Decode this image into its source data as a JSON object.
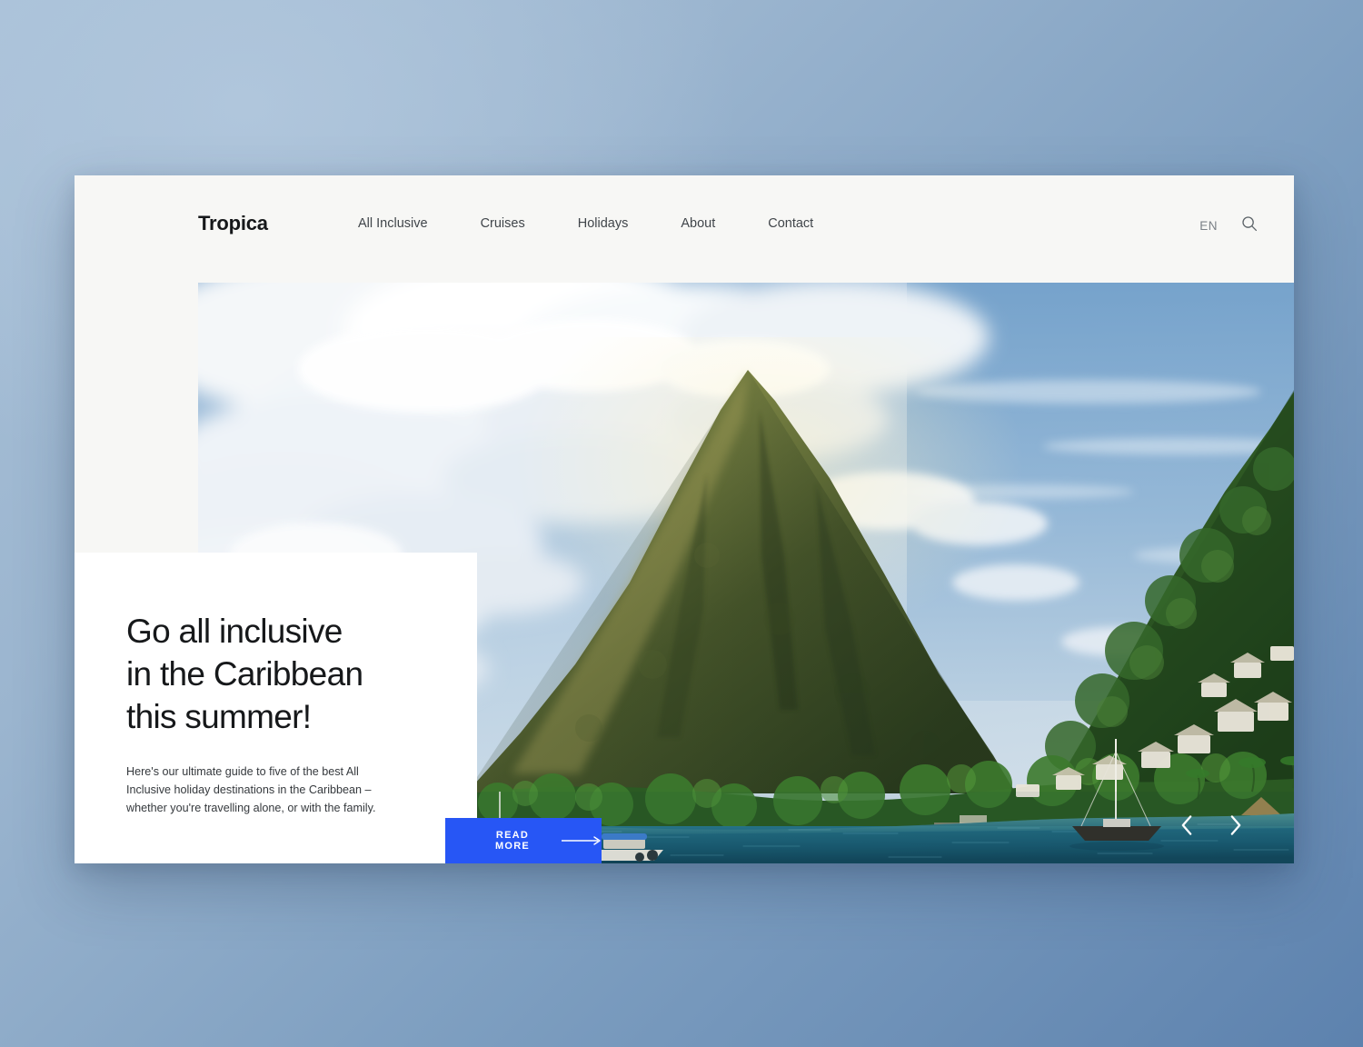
{
  "site": {
    "brand": "Tropica",
    "language": "EN",
    "search_icon": "search-icon"
  },
  "nav": {
    "items": [
      {
        "label": "All Inclusive"
      },
      {
        "label": "Cruises"
      },
      {
        "label": "Holidays"
      },
      {
        "label": "About"
      },
      {
        "label": "Contact"
      }
    ]
  },
  "hero": {
    "headline": "Go all inclusive\nin the Caribbean\nthis summer!",
    "body": "Here's our ultimate guide to five of the best All Inclusive holiday destinations in the Caribbean – whether you're travelling alone, or with the family.",
    "cta_label": "READ MORE",
    "cta_arrow_icon": "arrow-right-icon",
    "prev_icon": "chevron-left-icon",
    "next_icon": "chevron-right-icon",
    "scene": "Caribbean bay with a green pyramidal mountain peak, forested ridge with white hillside villas, sailboats and a motorboat on turquoise water under a blue sky with large white clouds"
  },
  "colors": {
    "accent_blue": "#2756f5",
    "header_bg": "#f7f7f5",
    "card_bg": "#ffffff",
    "text_dark": "#16181a",
    "text_muted": "#7b8187",
    "backdrop_light": "#a9c1d8",
    "backdrop_dark": "#5d82ae",
    "water": "#1c5e75",
    "foliage": "#2e5b2a"
  }
}
